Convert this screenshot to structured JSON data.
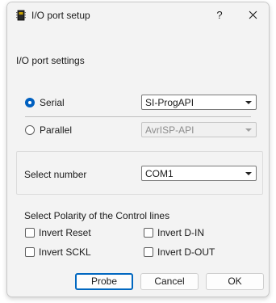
{
  "window": {
    "title": "I/O port setup",
    "help_label": "?"
  },
  "port_settings": {
    "title": "I/O port settings",
    "serial": {
      "label": "Serial",
      "selected": true,
      "combo_value": "SI-ProgAPI"
    },
    "parallel": {
      "label": "Parallel",
      "selected": false,
      "combo_value": "AvrISP-API",
      "combo_enabled": false
    }
  },
  "select_number": {
    "label": "Select number",
    "value": "COM1"
  },
  "polarity": {
    "title": "Select Polarity of the Control lines",
    "options": [
      {
        "label": "Invert Reset",
        "checked": false
      },
      {
        "label": "Invert D-IN",
        "checked": false
      },
      {
        "label": "Invert SCKL",
        "checked": false
      },
      {
        "label": "Invert D-OUT",
        "checked": false
      }
    ]
  },
  "buttons": {
    "probe": "Probe",
    "cancel": "Cancel",
    "ok": "OK"
  },
  "colors": {
    "accent": "#0067c0",
    "dialog_bg": "#f3f3f3"
  }
}
